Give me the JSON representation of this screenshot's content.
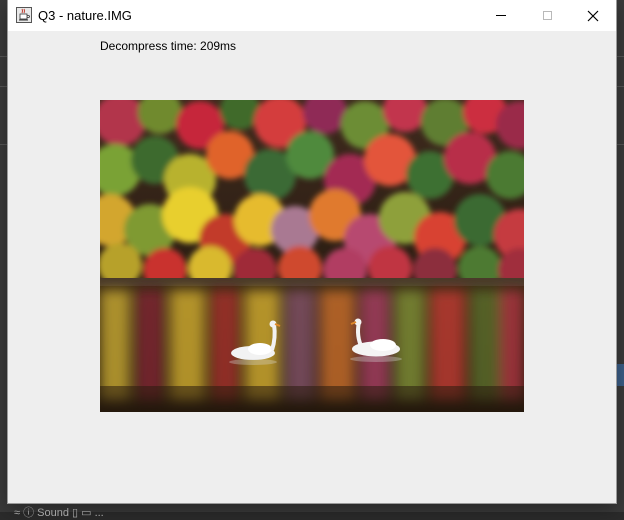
{
  "window": {
    "title": "Q3 - nature.IMG",
    "icons": {
      "app": "java-app-icon",
      "minimize": "minimize-icon",
      "maximize": "maximize-icon",
      "close": "close-icon"
    }
  },
  "content": {
    "decompress_text": "Decompress time: 209ms",
    "image": {
      "subject": "autumn-forest-lake-with-two-swans"
    }
  },
  "background": {
    "partial_text": "≈ ⓘ Sound ▯ ▭ ..."
  },
  "colors": {
    "window_bg": "#eeeeee",
    "titlebar_bg": "#ffffff",
    "desktop_bg": "#3a3a3a"
  }
}
